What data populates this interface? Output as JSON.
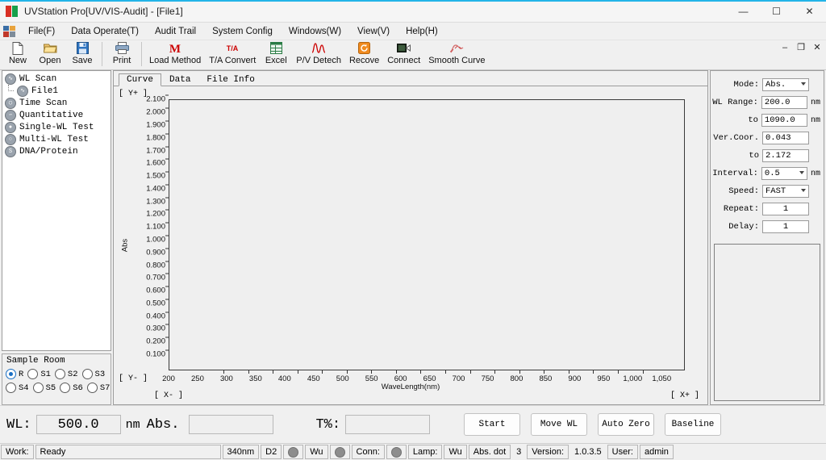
{
  "window": {
    "title": "UVStation Pro[UV/VIS-Audit] - [File1]",
    "minimize": "—",
    "maximize": "☐",
    "close": "✕",
    "accent_color": "#23b4e8"
  },
  "menubar": {
    "items": [
      {
        "label": "File(F)",
        "mnemonic": "F"
      },
      {
        "label": "Data Operate(T)",
        "mnemonic": "T"
      },
      {
        "label": "Audit Trail",
        "mnemonic": ""
      },
      {
        "label": "System Config",
        "mnemonic": ""
      },
      {
        "label": "Windows(W)",
        "mnemonic": "W"
      },
      {
        "label": "View(V)",
        "mnemonic": "V"
      },
      {
        "label": "Help(H)",
        "mnemonic": "H"
      }
    ]
  },
  "toolbar": {
    "items": [
      {
        "label": "New",
        "icon": "new-document-icon"
      },
      {
        "label": "Open",
        "icon": "open-folder-icon"
      },
      {
        "label": "Save",
        "icon": "floppy-disk-icon"
      },
      {
        "label": "Print",
        "icon": "printer-icon"
      },
      {
        "label": "Load Method",
        "icon": "method-m-icon"
      },
      {
        "label": "T/A Convert",
        "icon": "ta-convert-icon"
      },
      {
        "label": "Excel",
        "icon": "excel-icon"
      },
      {
        "label": "P/V Detech",
        "icon": "peak-valley-icon"
      },
      {
        "label": "Recove",
        "icon": "recover-icon"
      },
      {
        "label": "Connect",
        "icon": "connect-icon"
      },
      {
        "label": "Smooth Curve",
        "icon": "smooth-curve-icon"
      }
    ],
    "mdi": {
      "minimize": "–",
      "restore": "❐",
      "close": "✕"
    }
  },
  "tree": {
    "nodes": [
      {
        "label": "WL Scan",
        "icon": "wave-icon",
        "level": 0
      },
      {
        "label": "File1",
        "icon": "wave-icon",
        "level": 1
      },
      {
        "label": "Time Scan",
        "icon": "clock-icon",
        "level": 0
      },
      {
        "label": "Quantitative",
        "icon": "quant-icon",
        "level": 0
      },
      {
        "label": "Single-WL Test",
        "icon": "single-wl-icon",
        "level": 0
      },
      {
        "label": "Multi-WL Test",
        "icon": "multi-wl-icon",
        "level": 0
      },
      {
        "label": "DNA/Protein",
        "icon": "dna-icon",
        "level": 0
      }
    ]
  },
  "sample_room": {
    "title": "Sample Room",
    "selected": "R",
    "options": [
      "R",
      "S1",
      "S2",
      "S3",
      "S4",
      "S5",
      "S6",
      "S7"
    ]
  },
  "tabs": {
    "active": "Curve",
    "items": [
      "Curve",
      "Data",
      "File Info"
    ]
  },
  "chart_corners": {
    "y_plus": "[ Y+ ]",
    "y_minus": "[ Y- ]",
    "x_minus": "[ X- ]",
    "x_plus": "[ X+ ]"
  },
  "chart_data": {
    "type": "line",
    "title": "",
    "xlabel": "WaveLength(nm)",
    "ylabel": "Abs",
    "xlim": [
      200,
      1090
    ],
    "ylim": [
      0.043,
      2.172
    ],
    "grid": false,
    "legend": "none",
    "series": [],
    "x_ticks": [
      200,
      250,
      300,
      350,
      400,
      450,
      500,
      550,
      600,
      650,
      700,
      750,
      800,
      850,
      900,
      950,
      1000,
      1050
    ],
    "x_tick_labels": [
      "200",
      "250",
      "300",
      "350",
      "400",
      "450",
      "500",
      "550",
      "600",
      "650",
      "700",
      "750",
      "800",
      "850",
      "900",
      "950",
      "1,000",
      "1,050"
    ],
    "y_ticks": [
      0.1,
      0.2,
      0.3,
      0.4,
      0.5,
      0.6,
      0.7,
      0.8,
      0.9,
      1.0,
      1.1,
      1.2,
      1.3,
      1.4,
      1.5,
      1.6,
      1.7,
      1.8,
      1.9,
      2.0,
      2.1
    ],
    "y_tick_labels": [
      "0.100",
      "0.200",
      "0.300",
      "0.400",
      "0.500",
      "0.600",
      "0.700",
      "0.800",
      "0.900",
      "1.000",
      "1.100",
      "1.200",
      "1.300",
      "1.400",
      "1.500",
      "1.600",
      "1.700",
      "1.800",
      "1.900",
      "2.000",
      "2.100"
    ]
  },
  "params": {
    "rows": [
      {
        "label": "Mode:",
        "value": "Abs.",
        "unit": "",
        "type": "select"
      },
      {
        "label": "WL Range:",
        "value": "200.0",
        "unit": "nm",
        "type": "text"
      },
      {
        "label": "to",
        "value": "1090.0",
        "unit": "nm",
        "type": "text"
      },
      {
        "label": "Ver.Coor.",
        "value": "0.043",
        "unit": "",
        "type": "text"
      },
      {
        "label": "to",
        "value": "2.172",
        "unit": "",
        "type": "text"
      },
      {
        "label": "Interval:",
        "value": "0.5",
        "unit": "nm",
        "type": "select"
      },
      {
        "label": "Speed:",
        "value": "FAST",
        "unit": "",
        "type": "select"
      },
      {
        "label": "Repeat:",
        "value": "1",
        "unit": "",
        "type": "text-center"
      },
      {
        "label": "Delay:",
        "value": "1",
        "unit": "",
        "type": "text-center"
      }
    ]
  },
  "measure": {
    "wl_label": "WL:",
    "wl_value": "500.0",
    "wl_unit": "nm",
    "abs_label": "Abs.",
    "abs_value": "",
    "t_label": "T%:",
    "t_value": "",
    "buttons": [
      "Start",
      "Move WL",
      "Auto Zero",
      "Baseline"
    ]
  },
  "status": {
    "work_label": "Work:",
    "work_value": "Ready",
    "wavelength": "340nm",
    "lamp_type": "D2",
    "wu_1": "Wu",
    "conn_label": "Conn:",
    "lamp_label": "Lamp:",
    "wu_2": "Wu",
    "abs_dot_label": "Abs. dot",
    "abs_dot_value": "3",
    "version_label": "Version:",
    "version_value": "1.0.3.5",
    "user_label": "User:",
    "user_value": "admin"
  }
}
